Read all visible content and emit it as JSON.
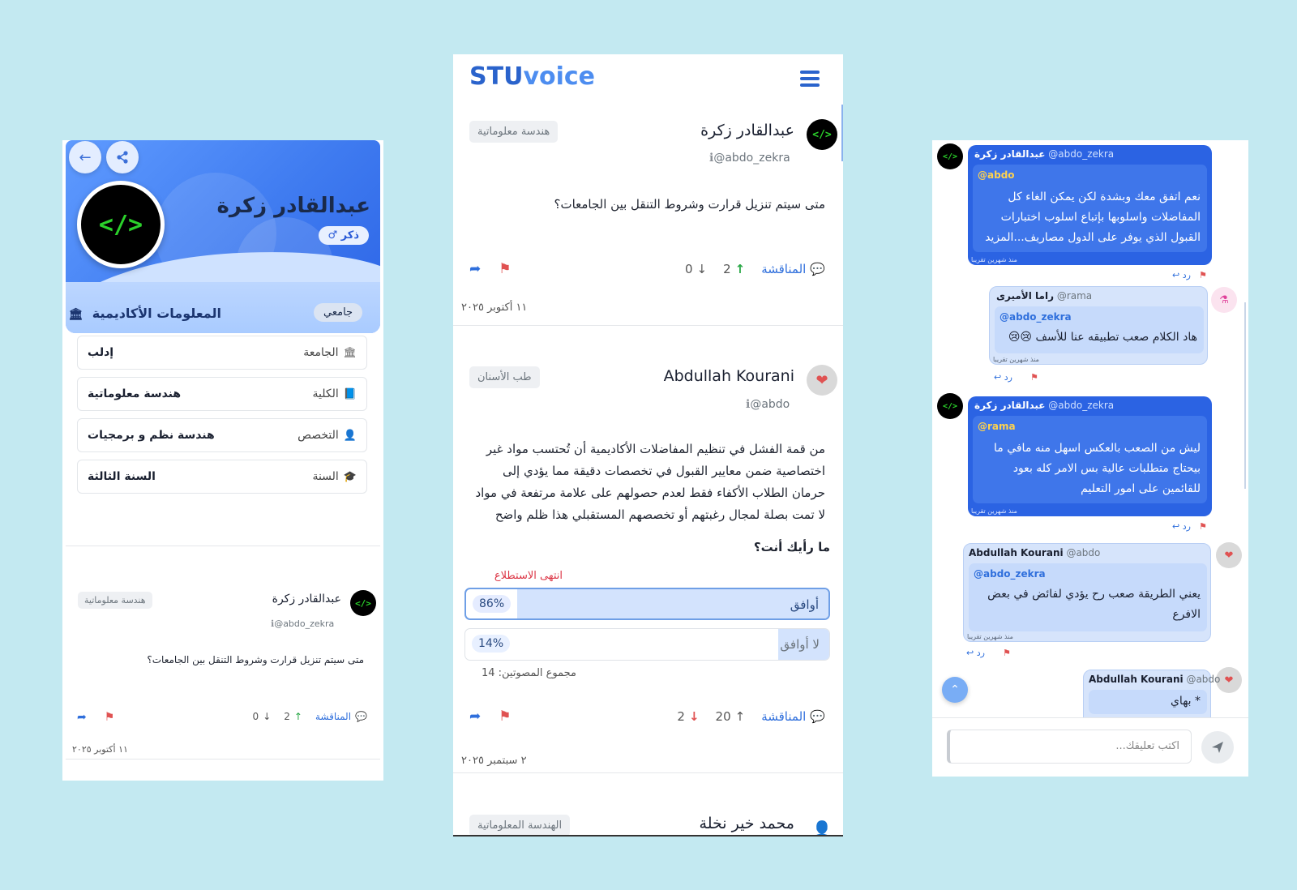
{
  "profile": {
    "name": "عبدالقادر زكرة",
    "gender_badge": "ذكر ♂",
    "academic_title": "المعلومات الأكاديمية",
    "role_badge": "جامعي",
    "rows": [
      {
        "label": "الجامعة",
        "value": "إدلب",
        "icon": "university-icon"
      },
      {
        "label": "الكلية",
        "value": "هندسة معلوماتية",
        "icon": "book-icon"
      },
      {
        "label": "التخصص",
        "value": "هندسة نظم و برمجيات",
        "icon": "user-tie-icon"
      },
      {
        "label": "السنة",
        "value": "السنة الثالثة",
        "icon": "graduation-cap-icon"
      }
    ],
    "post": {
      "author": "عبدالقادر زكرة",
      "handle": "@abdo_zekra",
      "category": "هندسة معلوماتية",
      "text": "متى سيتم تنزيل قرارت وشروط التنقل بين الجامعات؟",
      "discussion_label": "المناقشة",
      "upvotes": "2",
      "downvotes": "0",
      "date": "١١ أكتوبر ٢٠٢٥"
    }
  },
  "feed": {
    "brand_part1": "STU",
    "brand_part2": "voice",
    "posts": [
      {
        "author": "عبدالقادر زكرة",
        "handle": "@abdo_zekra",
        "category": "هندسة معلوماتية",
        "text": "متى سيتم تنزيل قرارت وشروط التنقل بين الجامعات؟",
        "discussion_label": "المناقشة",
        "upvotes": "2",
        "downvotes": "0",
        "date": "١١ أكتوبر ٢٠٢٥"
      },
      {
        "author": "Abdullah Kourani",
        "handle": "@abdo",
        "category": "طب الأسنان",
        "text_lines": [
          "من قمة الفشل في تنظيم المفاضلات الأكاديمية أن تُحتسب مواد غير",
          "اختصاصية ضمن معايير القبول في تخصصات دقيقة مما يؤدي إلى",
          "حرمان الطلاب الأكفاء فقط لعدم حصولهم على علامة مرتفعة في مواد",
          "لا تمت بصلة لمجال رغبتهم أو تخصصهم المستقبلي هذا ظلم واضح"
        ],
        "question": "ما رأيك أنت؟",
        "poll_status": "انتهى الاستطلاع",
        "poll_options": [
          {
            "label": "أوافق",
            "percent": "86%",
            "share": 86
          },
          {
            "label": "لا أوافق",
            "percent": "14%",
            "share": 14
          }
        ],
        "voters_total": "مجموع المصوتين: 14",
        "discussion_label": "المناقشة",
        "upvotes": "20",
        "downvotes": "2",
        "date": "٢ سبتمبر ٢٠٢٥"
      },
      {
        "author": "محمد خير نخلة",
        "category": "الهندسة المعلوماتية"
      }
    ]
  },
  "comments": {
    "items": [
      {
        "name": "عبدالقادر زكرة",
        "handle": "@abdo_zekra",
        "mention": "@abdo",
        "lines": [
          "نعم اتفق معك وبشدة لكن يمكن الغاء كل",
          "المفاضلات واسلوبها بإتباع اسلوب اختبارات",
          "القبول الذي يوفر على الدول مصاريف...المزيد"
        ],
        "time": "منذ شهرين تقريبا",
        "reply": "رد"
      },
      {
        "name": "راما الأميرى",
        "handle": "@rama",
        "mention": "@abdo_zekra",
        "lines": [
          "هاد الكلام صعب تطبيقه عنا للأسف 😢😢"
        ],
        "time": "منذ شهرين تقريبا",
        "reply": "رد"
      },
      {
        "name": "عبدالقادر زكرة",
        "handle": "@abdo_zekra",
        "mention": "@rama",
        "lines": [
          "ليش من الصعب بالعكس اسهل منه مافي ما",
          "بيحتاج متطلبات عالية بس الامر كله بعود",
          "للقائمين على امور التعليم"
        ],
        "time": "منذ شهرين تقريبا",
        "reply": "رد"
      },
      {
        "name": "Abdullah Kourani",
        "handle": "@abdo",
        "mention": "@abdo_zekra",
        "lines": [
          "يعني الطريقة صعب رح يؤدي لفائض في بعض",
          "الافرع"
        ],
        "time": "منذ شهرين تقريبا",
        "reply": "رد"
      },
      {
        "name": "Abdullah Kourani",
        "handle": "@abdo",
        "lines": [
          "* بهاي"
        ]
      }
    ],
    "input_placeholder": "اكتب تعليقك..."
  },
  "colors": {
    "background": "#c3e9f1",
    "accent": "#2f6fdc",
    "own_bubble": "#2b63e3",
    "other_bubble": "#d6e4fb"
  }
}
